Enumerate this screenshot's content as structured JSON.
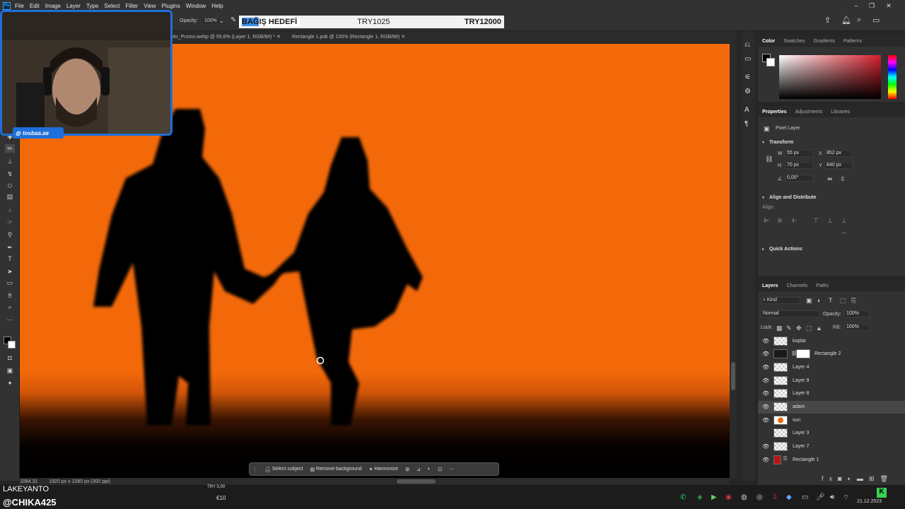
{
  "menu": {
    "app_logo": "Ps",
    "items": [
      "File",
      "Edit",
      "Image",
      "Layer",
      "Type",
      "Select",
      "Filter",
      "View",
      "Plugins",
      "Window",
      "Help"
    ]
  },
  "options_bar": {
    "opacity_label": "Opacity:",
    "opacity_value": "100%"
  },
  "donation": {
    "title_highlight": "BAĞ",
    "title_rest": "IŞ HEDEFİ",
    "current": "TRY1025",
    "goal": "TRY12000"
  },
  "tabs": [
    {
      "label": "oto_Promo.webp @ 55,6% (Layer 1, RGB/8#) *"
    },
    {
      "label": "Rectangle 1.psb @ 100% (Rectangle 1, RGB/8#)"
    }
  ],
  "webcam": {
    "badge": "tosbaa.ae"
  },
  "status": {
    "zoom": "1084.31",
    "doc_info": "1920 px x 1080 px (300 ppi)"
  },
  "context_bar": {
    "select_subject": "Select subject",
    "remove_background": "Remove background",
    "harmonize": "Harmonize"
  },
  "color_panel": {
    "tabs": [
      "Color",
      "Swatches",
      "Gradients",
      "Patterns"
    ],
    "active_tab": "Color",
    "picker_hue": "#d61f2c"
  },
  "properties": {
    "tabs": [
      "Properties",
      "Adjustments",
      "Libraries"
    ],
    "type_label": "Pixel Layer",
    "transform_title": "Transform",
    "w_label": "W",
    "w_value": "55 px",
    "h_label": "H",
    "h_value": "70 px",
    "x_label": "X",
    "x_value": "852 px",
    "y_label": "Y",
    "y_value": "840 px",
    "angle_value": "0,00°",
    "align_title": "Align and Distribute",
    "align_label": "Align:",
    "quick_actions": "Quick Actions"
  },
  "layers_panel": {
    "tabs": [
      "Layers",
      "Channels",
      "Paths"
    ],
    "filter_kind": "Kind",
    "blend_mode": "Normal",
    "opacity_label": "Opacity:",
    "opacity_value": "100%",
    "lock_label": "Lock:",
    "fill_label": "Fill:",
    "fill_value": "100%",
    "layers": [
      {
        "name": "koplar",
        "visible": true,
        "selected": false
      },
      {
        "name": "Rectangle 2",
        "visible": true,
        "selected": false
      },
      {
        "name": "Layer 4",
        "visible": true,
        "selected": false
      },
      {
        "name": "Layer 9",
        "visible": true,
        "selected": false
      },
      {
        "name": "Layer 8",
        "visible": true,
        "selected": false
      },
      {
        "name": "adam",
        "visible": true,
        "selected": true
      },
      {
        "name": "sun",
        "visible": true,
        "selected": false
      },
      {
        "name": "Layer 3",
        "visible": false,
        "selected": false
      },
      {
        "name": "Layer 7",
        "visible": true,
        "selected": false
      },
      {
        "name": "Rectangle 1",
        "visible": true,
        "selected": false
      }
    ]
  },
  "taskbar": {
    "overlay_name": "LAKEYANTO",
    "overlay_handle": "@CHIKA425",
    "donation_small": "TRY 5,00",
    "currency_amount": "€10",
    "date": "21.12.2023"
  },
  "colors": {
    "canvas_orange": "#f3690a",
    "accent_blue": "#1e6fd9",
    "panel_bg": "#323232"
  }
}
